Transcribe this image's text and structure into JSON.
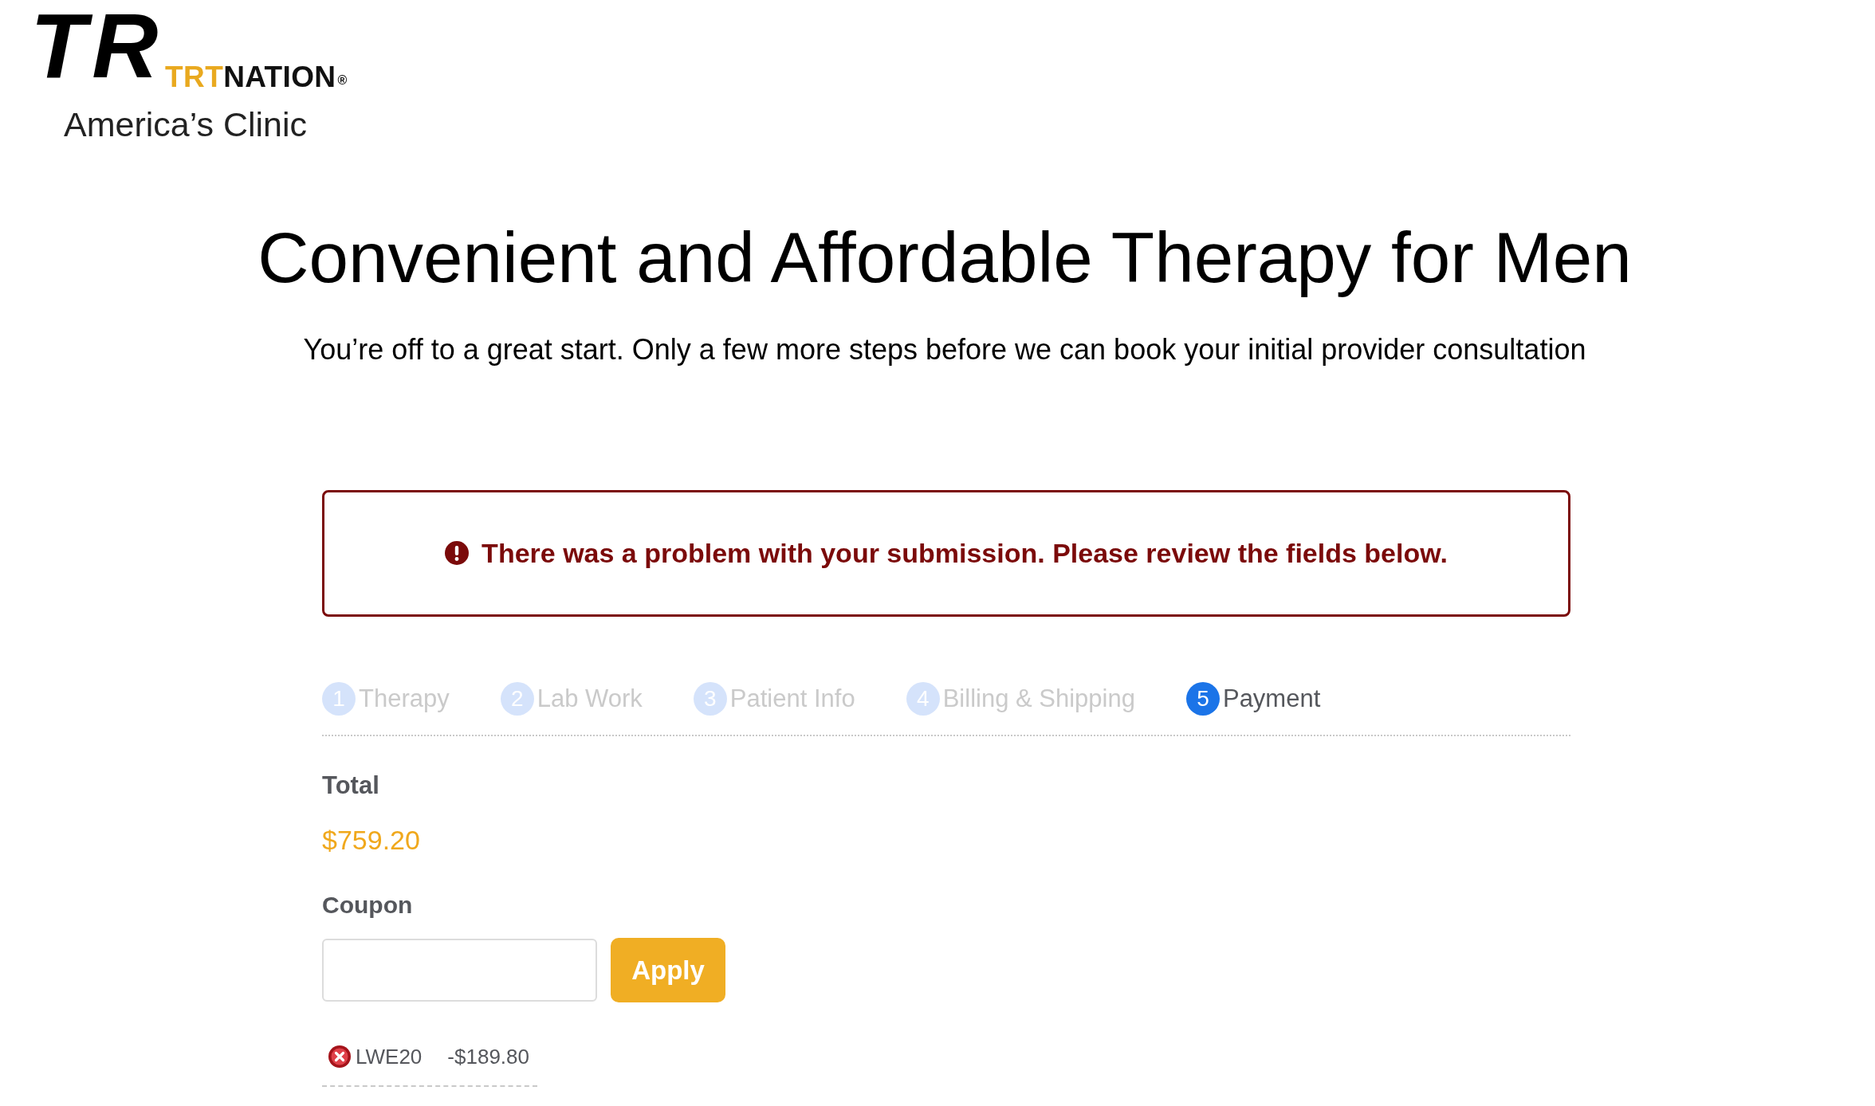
{
  "logo": {
    "monogram": "TR",
    "wordmark_accent": "TRT",
    "wordmark": "NATION",
    "registered": "®",
    "tagline": "America’s Clinic"
  },
  "heading": "Convenient and Affordable Therapy for Men",
  "subheading": "You’re off to a great start. Only a few more steps before we can book your initial provider consultation",
  "error_alert": {
    "message": "There was a problem with your submission. Please review the fields below."
  },
  "steps": [
    {
      "number": "1",
      "label": "Therapy",
      "selected": false
    },
    {
      "number": "2",
      "label": "Lab Work",
      "selected": false
    },
    {
      "number": "3",
      "label": "Patient Info",
      "selected": false
    },
    {
      "number": "4",
      "label": "Billing & Shipping",
      "selected": false
    },
    {
      "number": "5",
      "label": "Payment",
      "selected": true
    }
  ],
  "total": {
    "label": "Total",
    "amount": "$759.20"
  },
  "coupon": {
    "label": "Coupon",
    "button": "Apply",
    "applied": [
      {
        "code": "LWE20",
        "discount": "-$189.80"
      }
    ]
  }
}
